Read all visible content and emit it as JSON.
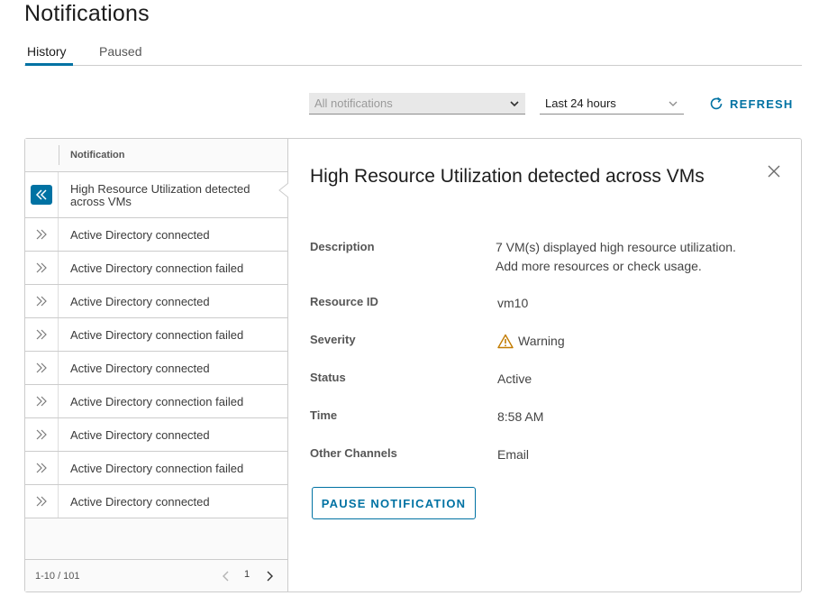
{
  "page": {
    "title": "Notifications"
  },
  "tabs": [
    {
      "label": "History"
    },
    {
      "label": "Paused"
    }
  ],
  "filters": {
    "type_value": "All notifications",
    "time_value": "Last 24 hours",
    "refresh_label": "REFRESH"
  },
  "list": {
    "column_header": "Notification",
    "rows": [
      {
        "title": "High Resource Utilization detected across VMs",
        "selected": true
      },
      {
        "title": "Active Directory connected"
      },
      {
        "title": "Active Directory connection failed"
      },
      {
        "title": "Active Directory connected"
      },
      {
        "title": "Active Directory connection failed"
      },
      {
        "title": "Active Directory connected"
      },
      {
        "title": "Active Directory connection failed"
      },
      {
        "title": "Active Directory connected"
      },
      {
        "title": "Active Directory connection failed"
      },
      {
        "title": "Active Directory connected"
      }
    ],
    "footer": {
      "range": "1-10 / 101",
      "page": "1"
    }
  },
  "detail": {
    "title": "High Resource Utilization detected across VMs",
    "fields": {
      "description": {
        "label": "Description",
        "value_line1": "7 VM(s) displayed high resource utilization.",
        "value_line2": "Add more resources or check usage."
      },
      "resource_id": {
        "label": "Resource ID",
        "value": "vm10"
      },
      "severity": {
        "label": "Severity",
        "value": "Warning",
        "icon": "warning-icon",
        "color": "#c27b00"
      },
      "status": {
        "label": "Status",
        "value": "Active"
      },
      "time": {
        "label": "Time",
        "value": "8:58 AM"
      },
      "other_channels": {
        "label": "Other Channels",
        "value": "Email"
      }
    },
    "pause_label": "PAUSE NOTIFICATION"
  },
  "colors": {
    "accent": "#0072a3",
    "border": "#cccccc",
    "warning": "#c27b00"
  }
}
